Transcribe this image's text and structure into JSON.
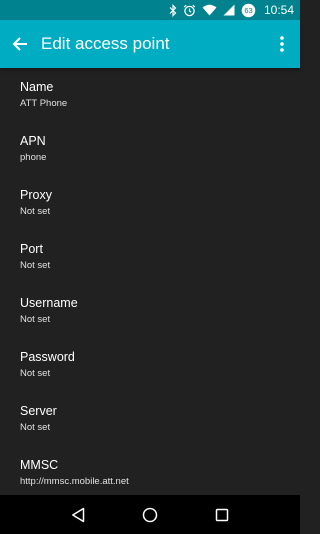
{
  "status_bar": {
    "time": "10:54",
    "battery_level": "63",
    "icons": [
      "bluetooth-icon",
      "alarm-icon",
      "wifi-icon",
      "signal-icon",
      "battery-icon"
    ]
  },
  "app_bar": {
    "title": "Edit access point",
    "back_icon": "arrow-back-icon",
    "overflow_icon": "more-vert-icon",
    "color": "#00acc1",
    "status_color": "#00838f"
  },
  "fields": [
    {
      "title": "Name",
      "summary": "ATT Phone"
    },
    {
      "title": "APN",
      "summary": "phone"
    },
    {
      "title": "Proxy",
      "summary": "Not set"
    },
    {
      "title": "Port",
      "summary": "Not set"
    },
    {
      "title": "Username",
      "summary": "Not set"
    },
    {
      "title": "Password",
      "summary": "Not set"
    },
    {
      "title": "Server",
      "summary": "Not set"
    },
    {
      "title": "MMSC",
      "summary": "http://mmsc.mobile.att.net"
    }
  ],
  "nav_bar": {
    "icons": [
      "nav-back-icon",
      "nav-home-icon",
      "nav-recents-icon"
    ]
  }
}
